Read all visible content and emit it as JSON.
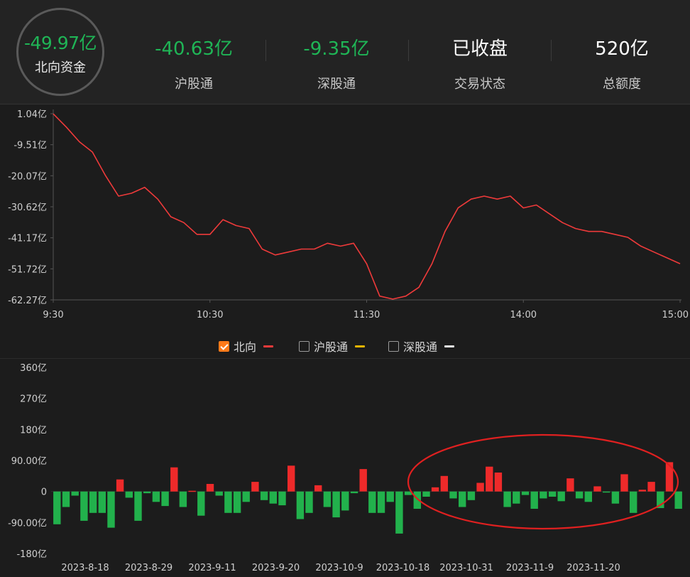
{
  "header": {
    "main": {
      "value": "-49.97亿",
      "label": "北向资金"
    },
    "stats": [
      {
        "value": "-40.63亿",
        "label": "沪股通",
        "color": "#1fb556"
      },
      {
        "value": "-9.35亿",
        "label": "深股通",
        "color": "#1fb556"
      },
      {
        "value": "已收盘",
        "label": "交易状态",
        "color": "#ffffff"
      },
      {
        "value": "520亿",
        "label": "总额度",
        "color": "#ffffff"
      }
    ]
  },
  "legend": {
    "items": [
      {
        "label": "北向",
        "checked": true,
        "color": "#ee3a3a"
      },
      {
        "label": "沪股通",
        "checked": false,
        "color": "#e8b400"
      },
      {
        "label": "深股通",
        "checked": false,
        "color": "#e8e8e8"
      }
    ]
  },
  "chart_data": [
    {
      "type": "line",
      "y_tick_labels": [
        "1.04亿",
        "-9.51亿",
        "-20.07亿",
        "-30.62亿",
        "-41.17亿",
        "-51.72亿",
        "-62.27亿"
      ],
      "ylim": [
        -62.27,
        1.04
      ],
      "x_tick_labels": [
        "9:30",
        "10:30",
        "11:30",
        "14:00",
        "15:00"
      ],
      "series": [
        {
          "name": "北向",
          "color": "#ee3a3a",
          "x": [
            "9:30",
            "9:35",
            "9:40",
            "9:45",
            "9:50",
            "9:55",
            "10:00",
            "10:05",
            "10:10",
            "10:15",
            "10:20",
            "10:25",
            "10:30",
            "10:35",
            "10:40",
            "10:45",
            "10:50",
            "10:55",
            "11:00",
            "11:05",
            "11:10",
            "11:15",
            "11:20",
            "11:25",
            "11:30",
            "13:05",
            "13:10",
            "13:15",
            "13:20",
            "13:25",
            "13:30",
            "13:35",
            "13:40",
            "13:45",
            "13:50",
            "13:55",
            "14:00",
            "14:05",
            "14:10",
            "14:15",
            "14:20",
            "14:25",
            "14:30",
            "14:35",
            "14:40",
            "14:45",
            "14:50",
            "14:55",
            "15:00"
          ],
          "values": [
            1.0,
            -3.5,
            -8.5,
            -12.0,
            -20.0,
            -27.0,
            -26.0,
            -24.0,
            -28.0,
            -34.0,
            -36.0,
            -40.0,
            -40.0,
            -35.0,
            -37.0,
            -38.0,
            -45.0,
            -47.0,
            -46.0,
            -45.0,
            -45.0,
            -43.0,
            -44.0,
            -43.0,
            -50.0,
            -61.0,
            -62.0,
            -61.0,
            -58.0,
            -50.0,
            -39.0,
            -31.0,
            -28.0,
            -27.0,
            -28.0,
            -27.0,
            -31.0,
            -30.0,
            -33.0,
            -36.0,
            -38.0,
            -39.0,
            -39.0,
            -40.0,
            -41.0,
            -44.0,
            -46.0,
            -48.0,
            -49.97
          ]
        }
      ]
    },
    {
      "type": "bar",
      "y_tick_labels": [
        "360亿",
        "270亿",
        "180亿",
        "90.00亿",
        "0",
        "-90.00亿",
        "-180亿"
      ],
      "ylim": [
        -180,
        360
      ],
      "x_tick_labels": [
        "2023-8-18",
        "2023-8-29",
        "2023-9-11",
        "2023-9-20",
        "2023-10-9",
        "2023-10-18",
        "2023-10-31",
        "2023-11-9",
        "2023-11-20"
      ],
      "pos_color": "#ee2a2a",
      "neg_color": "#22b14c",
      "values": [
        -95,
        -45,
        -12,
        -85,
        -62,
        -62,
        -105,
        35,
        -18,
        -85,
        -5,
        -30,
        -42,
        70,
        -45,
        2,
        -70,
        22,
        -12,
        -62,
        -62,
        -30,
        28,
        -25,
        -35,
        -40,
        75,
        -80,
        -62,
        18,
        -45,
        -75,
        -55,
        -5,
        65,
        -62,
        -62,
        -30,
        -122,
        -10,
        -50,
        -15,
        12,
        45,
        -20,
        -45,
        -25,
        25,
        72,
        55,
        -45,
        -35,
        -10,
        -50,
        -20,
        -15,
        -28,
        38,
        -20,
        -30,
        15,
        -2,
        -35,
        50,
        -62,
        5,
        28,
        -48,
        85,
        -50
      ],
      "annotation": {
        "shape": "ellipse",
        "color": "#e02020"
      }
    }
  ]
}
